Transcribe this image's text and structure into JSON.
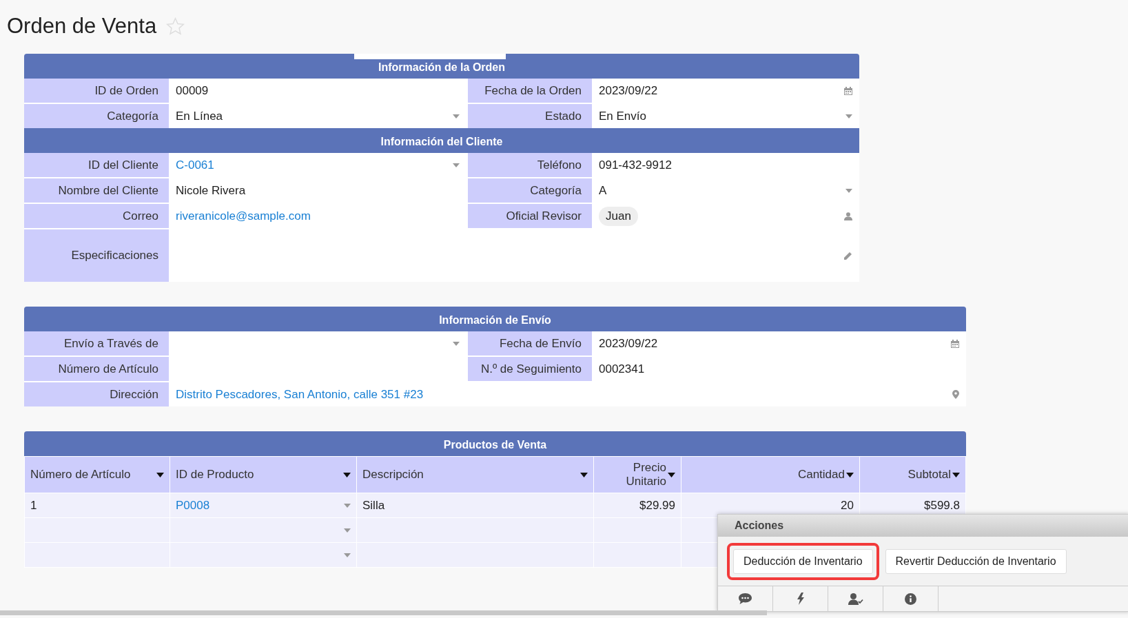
{
  "page": {
    "title": "Orden de Venta",
    "favorite": false
  },
  "cards": [
    {
      "sections": [
        {
          "title": "Información de la Orden",
          "rows": [
            {
              "fields": [
                {
                  "label": "ID de Orden",
                  "value": "00009",
                  "kind": "text"
                },
                {
                  "label": "Fecha de la Orden",
                  "value": "2023/09/22",
                  "kind": "date"
                }
              ]
            },
            {
              "fields": [
                {
                  "label": "Categoría",
                  "value": "En Línea",
                  "kind": "select"
                },
                {
                  "label": "Estado",
                  "value": "En Envío",
                  "kind": "select"
                }
              ]
            }
          ]
        },
        {
          "title": "Información del Cliente",
          "rows": [
            {
              "fields": [
                {
                  "label": "ID del Cliente",
                  "value": "C-0061",
                  "kind": "lookup"
                },
                {
                  "label": "Teléfono",
                  "value": "091-432-9912",
                  "kind": "text"
                }
              ]
            },
            {
              "fields": [
                {
                  "label": "Nombre del Cliente",
                  "value": "Nicole Rivera",
                  "kind": "text"
                },
                {
                  "label": "Categoría",
                  "value": "A",
                  "kind": "select"
                }
              ]
            },
            {
              "fields": [
                {
                  "label": "Correo",
                  "value": "riveranicole@sample.com",
                  "kind": "email"
                },
                {
                  "label": "Oficial Revisor",
                  "value": "Juan",
                  "kind": "user"
                }
              ]
            },
            {
              "fields": [
                {
                  "label": "Especificaciones",
                  "kind": "note"
                }
              ]
            }
          ]
        }
      ]
    },
    {
      "sections": [
        {
          "title": "Información de Envío",
          "rows": [
            {
              "fields": [
                {
                  "label": "Envío a Través de",
                  "kind": "select"
                },
                {
                  "label": "Fecha de Envío",
                  "value": "2023/09/22",
                  "kind": "date"
                }
              ]
            },
            {
              "fields": [
                {
                  "label": "Número de Artículo",
                  "kind": "text"
                },
                {
                  "label": "N.º de Seguimiento",
                  "value": "0002341",
                  "kind": "text"
                }
              ]
            },
            {
              "fields": [
                {
                  "label": "Dirección",
                  "value": "Distrito Pescadores, San Antonio, calle 351 #23",
                  "kind": "location"
                }
              ]
            }
          ]
        }
      ]
    }
  ],
  "table": {
    "title": "Productos de Venta",
    "columns": [
      {
        "label": "Número de Artículo",
        "kind": "text"
      },
      {
        "label": "ID de Producto",
        "kind": "lookup"
      },
      {
        "label": "Descripción",
        "kind": "text"
      },
      {
        "label": "Precio Unitario",
        "kind": "number"
      },
      {
        "label": "Cantidad",
        "kind": "number"
      },
      {
        "label": "Subtotal",
        "kind": "number"
      }
    ],
    "rows": [
      {
        "cells": [
          "1",
          "P0008",
          "Silla",
          "$29.99",
          "20",
          "$599.8"
        ]
      },
      {
        "cells": []
      },
      {
        "cells": []
      }
    ]
  },
  "actions": {
    "title": "Acciones",
    "buttons": [
      {
        "label": "Deducción de Inventario",
        "highlighted": true
      },
      {
        "label": "Revertir Deducción de Inventario",
        "highlighted": false
      }
    ],
    "tabs": [
      {
        "kind": "comment"
      },
      {
        "kind": "bolt"
      },
      {
        "kind": "user-check"
      },
      {
        "kind": "info"
      }
    ]
  }
}
